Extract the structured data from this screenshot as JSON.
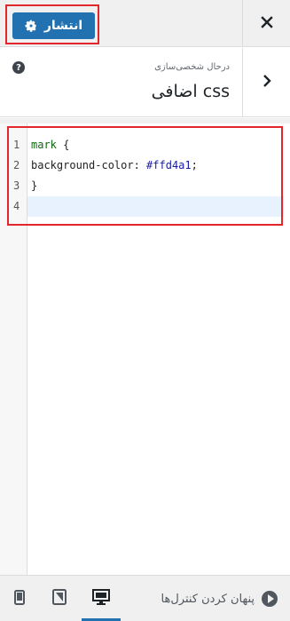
{
  "header": {
    "publish_label": "انتشار",
    "close_icon": "close-icon",
    "gear_icon": "gear-icon"
  },
  "section": {
    "breadcrumb": "درحال شخصی‌سازی",
    "title": "css اضافی",
    "help_icon": "help-icon",
    "back_icon": "chevron-right-icon"
  },
  "editor": {
    "lines": [
      {
        "num": "1",
        "selector": "mark",
        "rest": " {"
      },
      {
        "num": "2",
        "prop": "background-color:",
        "value": " #ffd4a1",
        "end": ";"
      },
      {
        "num": "3",
        "text": "}"
      },
      {
        "num": "4",
        "text": ""
      }
    ]
  },
  "footer": {
    "hide_controls_label": "پنهان کردن کنترل‌ها",
    "devices": [
      "desktop-icon",
      "tablet-icon",
      "mobile-icon"
    ],
    "active_device": "desktop"
  },
  "colors": {
    "primary": "#2271b1",
    "highlight_border": "#e3262c",
    "active_line": "#e8f2ff"
  }
}
